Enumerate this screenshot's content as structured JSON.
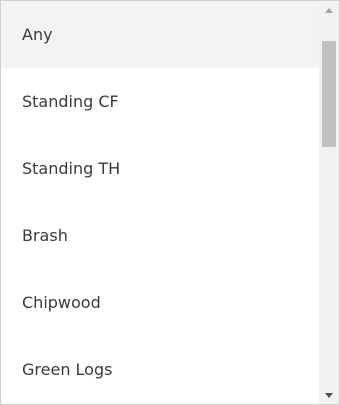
{
  "dropdown": {
    "options": [
      {
        "label": "Any"
      },
      {
        "label": "Standing CF"
      },
      {
        "label": "Standing TH"
      },
      {
        "label": "Brash"
      },
      {
        "label": "Chipwood"
      },
      {
        "label": "Green Logs"
      }
    ],
    "highlighted_index": 0
  },
  "scrollbar": {
    "up_icon": "triangle-up-icon",
    "down_icon": "triangle-down-icon"
  },
  "colors": {
    "highlight_bg": "#f3f3f3",
    "text": "#3a3a3a",
    "scrollbar_track": "#f1f1f1",
    "scrollbar_thumb": "#c1c1c1"
  }
}
